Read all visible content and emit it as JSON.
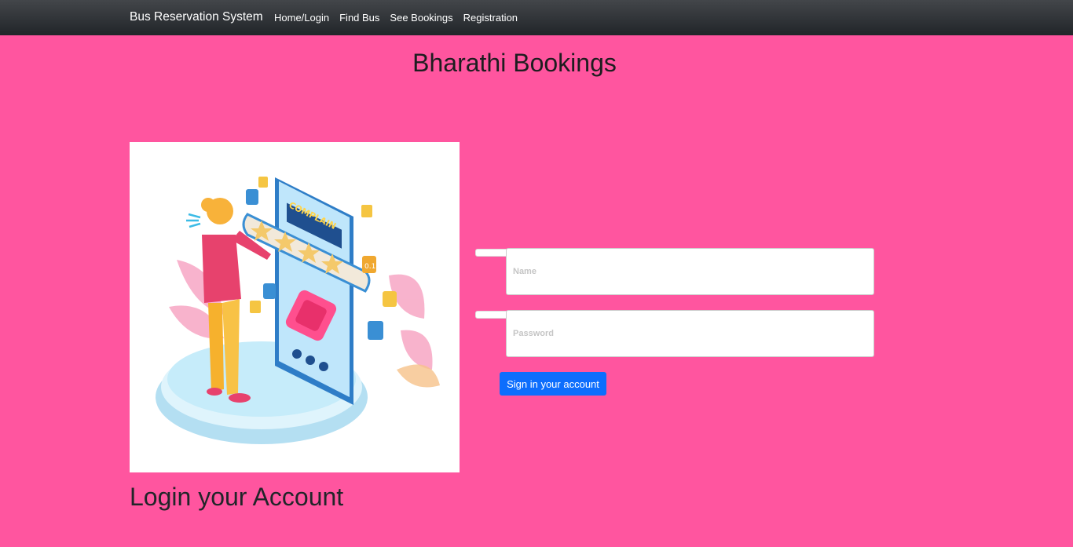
{
  "navbar": {
    "brand": "Bus Reservation System",
    "links": [
      "Home/Login",
      "Find Bus",
      "See Bookings",
      "Registration"
    ]
  },
  "page": {
    "title": "Bharathi Bookings",
    "login_heading": "Login your Account"
  },
  "illustration": {
    "screen_label": "COMPLAIN",
    "badge_text": "0.1"
  },
  "form": {
    "name_placeholder": "Name",
    "password_placeholder": "Password",
    "submit_label": "Sign in your account"
  },
  "colors": {
    "page_background": "#ff559f",
    "navbar": "#212529",
    "primary_button": "#0d6efd"
  }
}
